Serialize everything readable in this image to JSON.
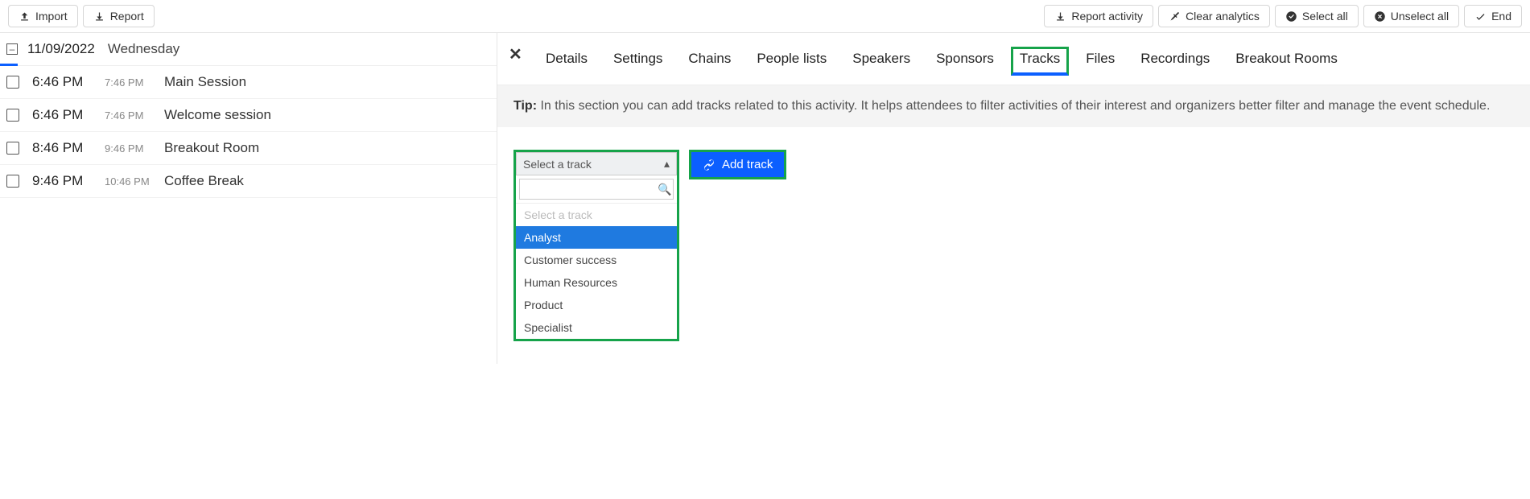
{
  "topbar": {
    "left": {
      "import": "Import",
      "report": "Report"
    },
    "right": {
      "report_activity": "Report activity",
      "clear_analytics": "Clear analytics",
      "select_all": "Select all",
      "unselect_all": "Unselect all",
      "end": "End"
    }
  },
  "schedule": {
    "date": "11/09/2022",
    "weekday": "Wednesday",
    "sessions": [
      {
        "start": "6:46 PM",
        "end": "7:46 PM",
        "title": "Main Session"
      },
      {
        "start": "6:46 PM",
        "end": "7:46 PM",
        "title": "Welcome session"
      },
      {
        "start": "8:46 PM",
        "end": "9:46 PM",
        "title": "Breakout Room"
      },
      {
        "start": "9:46 PM",
        "end": "10:46 PM",
        "title": "Coffee Break"
      }
    ]
  },
  "tabs": {
    "items": [
      "Details",
      "Settings",
      "Chains",
      "People lists",
      "Speakers",
      "Sponsors",
      "Tracks",
      "Files",
      "Recordings",
      "Breakout Rooms"
    ],
    "active_index": 6
  },
  "tip": {
    "label": "Tip:",
    "text": "In this section you can add tracks related to this activity. It helps attendees to filter activities of their interest and organizers better filter and manage the event schedule."
  },
  "track_select": {
    "placeholder_head": "Select a track",
    "placeholder_list": "Select a track",
    "search_value": "",
    "options": [
      "Analyst",
      "Customer success",
      "Human Resources",
      "Product",
      "Specialist"
    ],
    "highlight_index": 0
  },
  "add_track_button": "Add track"
}
